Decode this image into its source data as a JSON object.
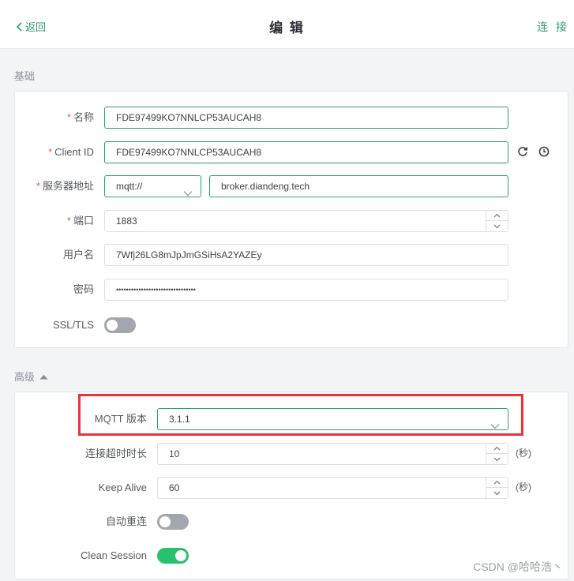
{
  "header": {
    "back_label": "返回",
    "title": "编 辑",
    "connect_label": "连 接"
  },
  "basic": {
    "section_title": "基础",
    "name": {
      "label": "名称",
      "required": true,
      "value": "FDE97499KO7NNLCP53AUCAH8"
    },
    "client_id": {
      "label": "Client ID",
      "required": true,
      "value": "FDE97499KO7NNLCP53AUCAH8"
    },
    "server": {
      "label": "服务器地址",
      "required": true,
      "protocol": "mqtt://",
      "host": "broker.diandeng.tech"
    },
    "port": {
      "label": "端口",
      "required": true,
      "value": "1883"
    },
    "username": {
      "label": "用户名",
      "value": "7Wfj26LG8mJpJmGSiHsA2YAZEy"
    },
    "password": {
      "label": "密码",
      "value": "••••••••••••••••••••••••••••••••"
    },
    "ssl": {
      "label": "SSL/TLS",
      "on": false
    }
  },
  "advanced": {
    "section_title": "高级",
    "mqtt_version": {
      "label": "MQTT 版本",
      "value": "3.1.1"
    },
    "connect_timeout": {
      "label": "连接超时时长",
      "value": "10",
      "unit": "(秒)"
    },
    "keep_alive": {
      "label": "Keep Alive",
      "value": "60",
      "unit": "(秒)"
    },
    "auto_reconnect": {
      "label": "自动重连",
      "on": false
    },
    "clean_session": {
      "label": "Clean Session",
      "on": true
    }
  },
  "watermark": "CSDN @哈哈浩丶",
  "colors": {
    "accent": "#2ea06a",
    "toggle_on": "#26c26b",
    "toggle_off": "#a2a7af",
    "highlight": "#e8343a"
  }
}
